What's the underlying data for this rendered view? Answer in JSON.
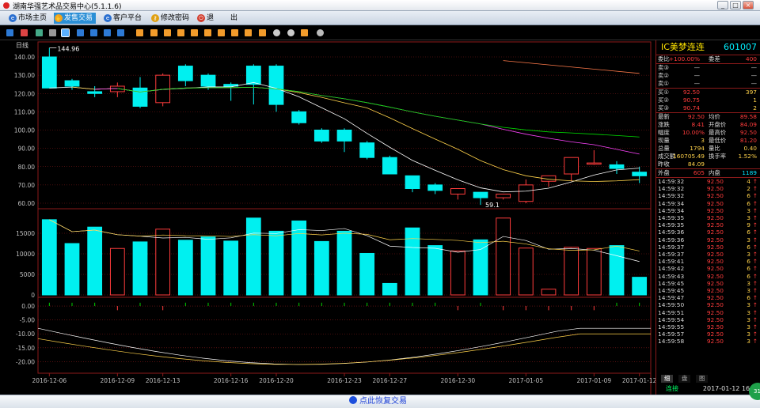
{
  "window": {
    "title": "湖南华强艺术品交易中心(5.1.1.6)"
  },
  "menu": {
    "items": [
      {
        "label": "市场主页",
        "icon": "globe-icon"
      },
      {
        "label": "发售交易",
        "icon": "handshake-icon",
        "active": true
      },
      {
        "label": "客户平台",
        "icon": "globe-icon"
      },
      {
        "label": "修改密码",
        "icon": "key-icon"
      },
      {
        "label": "退",
        "icon": "power-icon"
      },
      {
        "label": "出",
        "icon": ""
      }
    ]
  },
  "chart": {
    "period_label": "日线",
    "price_axis": [
      "140.00",
      "130.00",
      "120.00",
      "110.00",
      "100.00",
      "90.00",
      "80.00",
      "70.00",
      "60.00"
    ],
    "volume_axis": [
      "15000",
      "10000",
      "5000",
      "0"
    ],
    "macd_axis": [
      "0.00",
      "-5.00",
      "-10.00",
      "-15.00",
      "-20.00"
    ],
    "high_marker": "144.96",
    "low_marker": "59.1",
    "date_labels": [
      "2016-12-06",
      "2016-12-09",
      "2016-12-13",
      "2016-12-16",
      "2016-12-20",
      "2016-12-23",
      "2016-12-27",
      "2016-12-30",
      "2017-01-05",
      "2017-01-09",
      "2017-01-12"
    ]
  },
  "chart_data": {
    "type": "candlestick",
    "x": [
      "2016-12-06",
      "2016-12-07",
      "2016-12-08",
      "2016-12-09",
      "2016-12-12",
      "2016-12-13",
      "2016-12-14",
      "2016-12-15",
      "2016-12-16",
      "2016-12-19",
      "2016-12-20",
      "2016-12-21",
      "2016-12-22",
      "2016-12-23",
      "2016-12-26",
      "2016-12-27",
      "2016-12-28",
      "2016-12-29",
      "2016-12-30",
      "2017-01-03",
      "2017-01-04",
      "2017-01-05",
      "2017-01-06",
      "2017-01-09",
      "2017-01-10",
      "2017-01-11",
      "2017-01-12"
    ],
    "ohlc": [
      [
        140,
        144.96,
        123,
        123
      ],
      [
        127,
        128,
        122,
        124
      ],
      [
        121,
        124,
        118,
        120
      ],
      [
        121,
        126,
        118,
        124
      ],
      [
        123,
        129,
        112,
        113
      ],
      [
        115,
        131,
        113,
        130
      ],
      [
        135,
        136,
        124,
        127
      ],
      [
        130,
        131,
        122,
        124
      ],
      [
        125,
        126,
        116,
        124
      ],
      [
        135,
        136,
        114,
        125
      ],
      [
        135,
        136,
        110,
        114
      ],
      [
        110,
        111,
        103,
        104
      ],
      [
        100,
        101,
        93,
        94
      ],
      [
        100,
        101,
        88,
        94
      ],
      [
        93,
        94,
        84,
        85
      ],
      [
        85,
        86,
        76,
        76
      ],
      [
        75,
        75,
        66,
        68
      ],
      [
        70,
        71,
        65,
        67
      ],
      [
        65,
        67,
        62,
        68
      ],
      [
        66,
        66,
        59.1,
        63
      ],
      [
        63,
        64,
        62,
        65
      ],
      [
        61,
        73,
        60,
        70
      ],
      [
        72,
        75,
        69,
        75
      ],
      [
        76,
        83,
        72,
        85
      ],
      [
        82,
        89,
        81,
        82
      ],
      [
        81,
        83,
        76,
        79
      ],
      [
        77,
        80,
        71,
        75
      ]
    ],
    "volume": [
      18300,
      12500,
      16500,
      11300,
      12900,
      16000,
      13300,
      14100,
      13100,
      18700,
      15500,
      18000,
      13000,
      15500,
      10100,
      2800,
      16300,
      12000,
      10700,
      13400,
      18700,
      11400,
      1400,
      11600,
      11300,
      12000,
      4300
    ],
    "ma_lines": 4,
    "macd_range": [
      -23,
      0
    ]
  },
  "quote": {
    "name": "IC美梦连连",
    "code": "601007",
    "header": {
      "weibi_label": "委比",
      "weibi_val": "+100.00%",
      "weicha_label": "委差",
      "weicha_val": "400"
    },
    "sell": [
      {
        "label": "卖③",
        "price": "—",
        "vol": "—"
      },
      {
        "label": "卖②",
        "price": "—",
        "vol": "—"
      },
      {
        "label": "卖①",
        "price": "—",
        "vol": "—"
      }
    ],
    "buy": [
      {
        "label": "买①",
        "price": "92.50",
        "vol": "397"
      },
      {
        "label": "买②",
        "price": "90.75",
        "vol": "1"
      },
      {
        "label": "买③",
        "price": "90.74",
        "vol": "2"
      }
    ],
    "stats": [
      {
        "l": "最新",
        "v": "92.50",
        "l2": "均价",
        "v2": "89.58"
      },
      {
        "l": "涨跌",
        "v": "8.41",
        "l2": "开盘价",
        "v2": "84.09"
      },
      {
        "l": "幅度",
        "v": "10.00%",
        "l2": "最高价",
        "v2": "92.50"
      },
      {
        "l": "现量",
        "v": "3",
        "l2": "最低价",
        "v2": "81.20"
      },
      {
        "l": "总量",
        "v": "1794",
        "l2": "量比",
        "v2": "0.40"
      },
      {
        "l": "成交额",
        "v": "160705.49",
        "l2": "换手率",
        "v2": "1.52%"
      },
      {
        "l": "昨收",
        "v": "84.09",
        "l2": "",
        "v2": ""
      }
    ],
    "outer": {
      "l": "外盘",
      "v": "605",
      "l2": "内盘",
      "v2": "1189"
    },
    "ticks": [
      {
        "t": "14:59:32",
        "p": "92.50",
        "v": "4"
      },
      {
        "t": "14:59:32",
        "p": "92.50",
        "v": "2"
      },
      {
        "t": "14:59:32",
        "p": "92.50",
        "v": "6"
      },
      {
        "t": "14:59:34",
        "p": "92.50",
        "v": "6"
      },
      {
        "t": "14:59:34",
        "p": "92.50",
        "v": "3"
      },
      {
        "t": "14:59:35",
        "p": "92.50",
        "v": "3"
      },
      {
        "t": "14:59:35",
        "p": "92.50",
        "v": "9"
      },
      {
        "t": "14:59:36",
        "p": "92.50",
        "v": "6"
      },
      {
        "t": "14:59:36",
        "p": "92.50",
        "v": "3"
      },
      {
        "t": "14:59:37",
        "p": "92.50",
        "v": "6"
      },
      {
        "t": "14:59:37",
        "p": "92.50",
        "v": "3"
      },
      {
        "t": "14:59:41",
        "p": "92.50",
        "v": "6"
      },
      {
        "t": "14:59:42",
        "p": "92.50",
        "v": "6"
      },
      {
        "t": "14:59:43",
        "p": "92.50",
        "v": "6"
      },
      {
        "t": "14:59:45",
        "p": "92.50",
        "v": "3"
      },
      {
        "t": "14:59:45",
        "p": "92.50",
        "v": "3"
      },
      {
        "t": "14:59:47",
        "p": "92.50",
        "v": "6"
      },
      {
        "t": "14:59:50",
        "p": "92.50",
        "v": "3"
      },
      {
        "t": "14:59:51",
        "p": "92.50",
        "v": "3"
      },
      {
        "t": "14:59:54",
        "p": "92.50",
        "v": "3"
      },
      {
        "t": "14:59:55",
        "p": "92.50",
        "v": "3"
      },
      {
        "t": "14:59:57",
        "p": "92.50",
        "v": "3"
      },
      {
        "t": "14:59:58",
        "p": "92.50",
        "v": "3"
      }
    ],
    "tabs": [
      "细",
      "盘",
      "图"
    ],
    "status_left": "连接",
    "status_time": "2017-01-12  16:00"
  },
  "bottom": {
    "restore_label": "点此恢复交易"
  },
  "colors": {
    "up": "#ff3c3c",
    "down": "#00f0f0",
    "grid": "#8b1a1a",
    "axis_text": "#c0c0c0",
    "bg": "#000000"
  }
}
